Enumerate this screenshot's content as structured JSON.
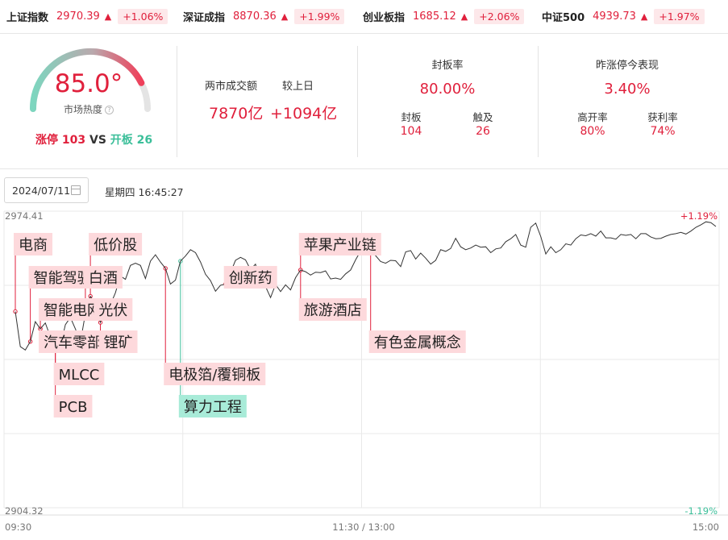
{
  "tickers": [
    {
      "name": "上证指数",
      "price": "2970.39",
      "arrow": "▲",
      "change": "+1.06%"
    },
    {
      "name": "深证成指",
      "price": "8870.36",
      "arrow": "▲",
      "change": "+1.99%"
    },
    {
      "name": "创业板指",
      "price": "1685.12",
      "arrow": "▲",
      "change": "+2.06%"
    },
    {
      "name": "中证500",
      "price": "4939.73",
      "arrow": "▲",
      "change": "+1.97%"
    }
  ],
  "heat": {
    "value": "85.0°",
    "gauge_fraction": 0.85,
    "label": "市场热度",
    "help_icon": "question-circle-icon",
    "limit_up_label": "涨停",
    "limit_up_count": "103",
    "vs": "VS",
    "open_label": "开板",
    "open_count": "26"
  },
  "turnover": {
    "label": "两市成交额",
    "compare_label": "较上日",
    "value": "7870亿",
    "delta": "+1094亿"
  },
  "seal": {
    "title": "封板率",
    "rate": "80.00%",
    "sealed_label": "封板",
    "touched_label": "触及",
    "sealed_value": "104",
    "touched_value": "26"
  },
  "yesterday": {
    "title": "昨涨停今表现",
    "rate": "3.40%",
    "high_open_label": "高开率",
    "profit_label": "获利率",
    "high_open_value": "80%",
    "profit_value": "74%"
  },
  "toolbar": {
    "date": "2024/07/11",
    "calendar_icon": "calendar-icon",
    "weekday_time": "星期四 16:45:27"
  },
  "chart_data": {
    "type": "line",
    "y_top_label": "2974.41",
    "y_bottom_label": "2904.32",
    "pct_top_label": "+1.19%",
    "pct_bottom_label": "-1.19%",
    "x_labels": [
      "09:30",
      "11:30 / 13:00",
      "15:00"
    ],
    "ylim": [
      2904.32,
      2974.41
    ],
    "series": [
      {
        "values": [
          2950.7,
          2942.4,
          2941.6,
          2943.6,
          2948.3,
          2946.6,
          2948.0,
          2944.7,
          2945.2,
          2942.4,
          2947.6,
          2949.3,
          2946.6,
          2943.4,
          2950.2,
          2954.3,
          2952.6,
          2948.1,
          2951.8,
          2952.3,
          2955.1,
          2959.1,
          2958.3,
          2961.6,
          2962.1,
          2961.6,
          2958.5,
          2962.6,
          2964.1,
          2962.4,
          2960.9,
          2957.2,
          2958.1,
          2962.6,
          2963.8,
          2965.3,
          2964.6,
          2962.4,
          2959.5,
          2958.0,
          2955.5,
          2956.9,
          2957.2,
          2959.9,
          2962.8,
          2963.5,
          2962.9,
          2960.6,
          2961.9,
          2957.6,
          2956.6,
          2954.0,
          2957.1,
          2955.4,
          2957.0,
          2955.8,
          2958.7,
          2960.5,
          2960.1,
          2959.3,
          2960.0,
          2959.9,
          2960.3,
          2958.4,
          2958.6,
          2958.3,
          2959.6,
          2960.5,
          2962.9,
          2965.0,
          2966.1,
          2966.0,
          2963.9,
          2962.5,
          2962.1,
          2962.8,
          2962.7,
          2961.3,
          2964.8,
          2965.1,
          2963.1,
          2964.5,
          2963.3,
          2961.9,
          2962.8,
          2965.3,
          2964.9,
          2965.6,
          2968.0,
          2966.0,
          2965.3,
          2965.7,
          2966.4,
          2965.9,
          2966.0,
          2964.6,
          2965.5,
          2965.7,
          2967.2,
          2967.9,
          2968.9,
          2966.4,
          2965.9,
          2970.6,
          2971.6,
          2968.4,
          2964.3,
          2966.0,
          2964.6,
          2965.3,
          2966.7,
          2966.4,
          2967.9,
          2968.8,
          2968.6,
          2969.1,
          2968.5,
          2969.7,
          2968.1,
          2968.1,
          2967.8,
          2968.9,
          2968.7,
          2968.9,
          2967.9,
          2969.1,
          2969.1,
          2968.3,
          2967.9,
          2968.0,
          2968.5,
          2968.9,
          2969.1,
          2969.4,
          2969.0,
          2969.7,
          2970.6,
          2971.2,
          2971.9,
          2971.7,
          2970.8
        ]
      }
    ],
    "annotations": [
      {
        "label": "电商",
        "kind": "up",
        "x": 0.4,
        "y_row": 0
      },
      {
        "label": "智能驾驶",
        "kind": "up",
        "x": 2.5,
        "y_row": 1
      },
      {
        "label": "白酒",
        "kind": "up",
        "x": 13.5,
        "y_row": 1
      },
      {
        "label": "低价股",
        "kind": "up",
        "x": 15.0,
        "y_row": 0
      },
      {
        "label": "智能电网",
        "kind": "up",
        "x": 4.5,
        "y_row": 2
      },
      {
        "label": "光伏",
        "kind": "up",
        "x": 16.0,
        "y_row": 2
      },
      {
        "label": "汽车零部件",
        "kind": "up",
        "x": 5.0,
        "y_row": 3
      },
      {
        "label": "锂矿",
        "kind": "up",
        "x": 16.6,
        "y_row": 3
      },
      {
        "label": "MLCC",
        "kind": "up",
        "x": 7.5,
        "y_row": 4
      },
      {
        "label": "PCB",
        "kind": "up",
        "x": 8.0,
        "y_row": 5
      },
      {
        "label": "电极箔/覆铜板",
        "kind": "up",
        "x": 30.0,
        "y_row": 4
      },
      {
        "label": "算力工程",
        "kind": "down",
        "x": 33.0,
        "y_row": 5
      },
      {
        "label": "创新药",
        "kind": "up",
        "x": 42.0,
        "y_row": 1
      },
      {
        "label": "苹果产业链",
        "kind": "up",
        "x": 57.0,
        "y_row": 0
      },
      {
        "label": "旅游酒店",
        "kind": "up",
        "x": 57.0,
        "y_row": 2
      },
      {
        "label": "有色金属概念",
        "kind": "up",
        "x": 71.0,
        "y_row": 3
      }
    ],
    "colors": {
      "up": "#e0203c",
      "down": "#3cbf9a",
      "up_tag_bg": "#fdd9dc",
      "down_tag_bg": "#a8ebd8",
      "line": "#333333",
      "grid": "#e9e9e9"
    }
  }
}
